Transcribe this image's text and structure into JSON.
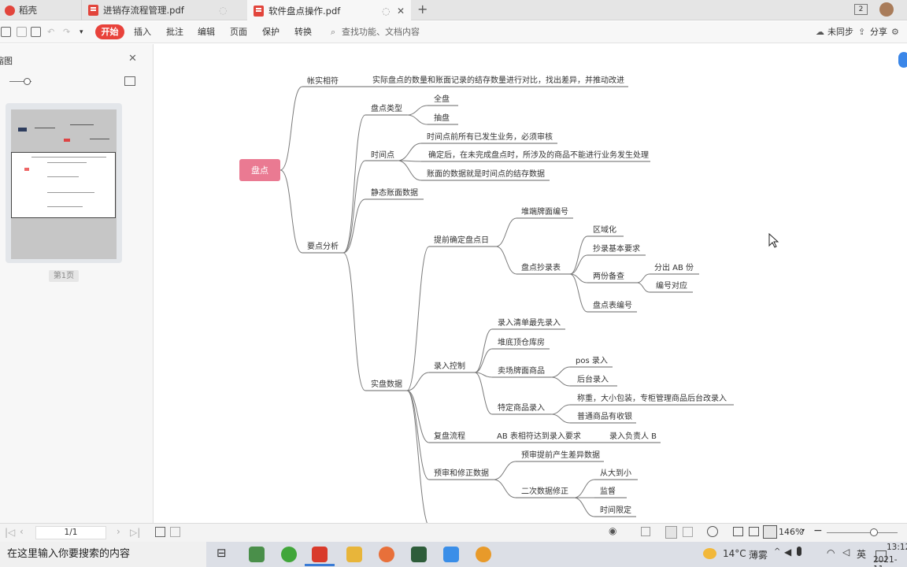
{
  "tabs": [
    {
      "label": "稻壳"
    },
    {
      "label": "进销存流程管理.pdf"
    },
    {
      "label": "软件盘点操作.pdf"
    }
  ],
  "tabbar": {
    "new_tab": "+",
    "badge": "2"
  },
  "toolbar": {
    "start": "开始",
    "menu": [
      "插入",
      "批注",
      "编辑",
      "页面",
      "保护",
      "转换"
    ],
    "search_placeholder": "查找功能、文档内容",
    "sync": "未同步",
    "share": "分享"
  },
  "sidebar": {
    "title": "缩图",
    "page_label": "第1页"
  },
  "mindmap": {
    "root": "盘点",
    "n1": "帐实相符",
    "n1_desc": "实际盘点的数量和账面记录的结存数量进行对比，找出差异，并推动改进",
    "n2": "要点分析",
    "type": "盘点类型",
    "type_a": "全盘",
    "type_b": "抽盘",
    "time": "时间点",
    "time_a": "时间点前所有已发生业务，必须审核",
    "time_b": "确定后，在未完成盘点时，所涉及的商品不能进行业务发生处理",
    "time_c": "账面的数据就是时间点的结存数据",
    "static": "静态账面数据",
    "actual": "实盘数据",
    "pre": "提前确定盘点日",
    "pre_a": "堆端牌面编号",
    "pre_b": "盘点抄录表",
    "pre_b1": "区域化",
    "pre_b2": "抄录基本要求",
    "pre_b3": "两份备查",
    "pre_b3a": "分出 AB 份",
    "pre_b3b": "编号对应",
    "pre_b4": "盘点表编号",
    "entry": "录入控制",
    "entry_a": "录入清单最先录入",
    "entry_b": "堆底顶仓库房",
    "entry_c": "卖场牌面商品",
    "entry_c1": "pos 录入",
    "entry_c2": "后台录入",
    "entry_d": "特定商品录入",
    "entry_d1": "称重，大小包装，专柜管理商品后台改录入",
    "entry_d2": "普通商品有收银",
    "recheck": "复盘流程",
    "recheck_a": "AB 表相符达到录入要求",
    "recheck_b": "录入负责人 B",
    "audit": "预审和修正数据",
    "audit_a": "预审提前产生差异数据",
    "audit_b": "二次数据修正",
    "audit_b1": "从大到小",
    "audit_b2": "监督",
    "audit_b3": "时间限定"
  },
  "statusbar": {
    "page": "1/1",
    "zoom": "146%"
  },
  "taskbar": {
    "search": "在这里输入你要搜索的内容",
    "weather_temp": "14°C",
    "weather_desc": "薄雾",
    "ime": "英",
    "time": "13:12",
    "date": "2021-11-"
  },
  "colors": {
    "accent": "#e8423b",
    "root_node": "#ea7a92",
    "branch": "#7a7a7a"
  }
}
